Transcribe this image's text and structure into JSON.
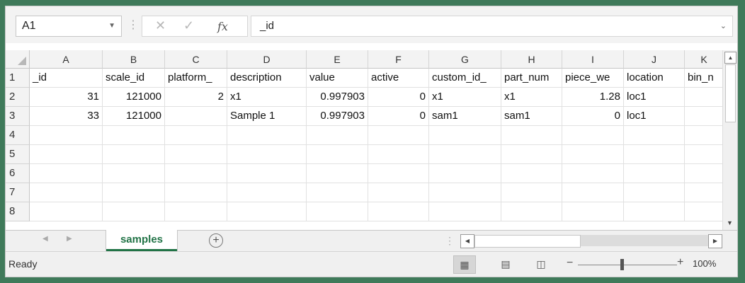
{
  "formula_bar": {
    "name_box": "A1",
    "cancel_glyph": "✕",
    "enter_glyph": "✓",
    "fx_label": "fx",
    "formula_value": "_id"
  },
  "columns": [
    "A",
    "B",
    "C",
    "D",
    "E",
    "F",
    "G",
    "H",
    "I",
    "J",
    "K"
  ],
  "rows": [
    "1",
    "2",
    "3",
    "4",
    "5",
    "6",
    "7",
    "8"
  ],
  "cells": [
    [
      "_id",
      "scale_id",
      "platform_",
      "description",
      "value",
      "active",
      "custom_id_",
      "part_num",
      "piece_we",
      "location",
      "bin_n"
    ],
    [
      "31",
      "121000",
      "2",
      "x1",
      "0.997903",
      "0",
      "x1",
      "x1",
      "1.28",
      "loc1",
      ""
    ],
    [
      "33",
      "121000",
      "",
      "Sample 1",
      "0.997903",
      "0",
      "sam1",
      "sam1",
      "0",
      "loc1",
      ""
    ]
  ],
  "sheet_tab": "samples",
  "add_sheet_glyph": "+",
  "status": "Ready",
  "zoom": {
    "minus": "−",
    "plus": "+",
    "level": "100%"
  },
  "icons": {
    "corner": "select-all-icon",
    "scroll_up": "▲",
    "scroll_down": "▼",
    "scroll_left": "◀",
    "scroll_right": "▶",
    "tab_prev": "◀",
    "tab_next": "▶",
    "normal_view": "▦",
    "page_layout": "▤",
    "page_break": "◫"
  }
}
